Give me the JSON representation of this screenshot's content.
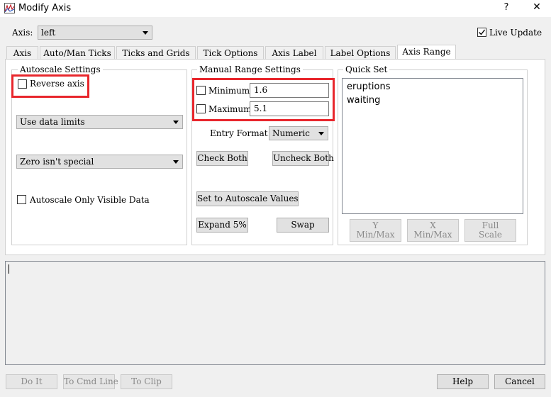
{
  "window": {
    "title": "Modify Axis",
    "help_label": "?",
    "close_label": "✕"
  },
  "axis": {
    "label": "Axis:",
    "selected": "left"
  },
  "live_update": {
    "label": "Live Update",
    "checked": true
  },
  "tabs": [
    {
      "label": "Axis"
    },
    {
      "label": "Auto/Man Ticks"
    },
    {
      "label": "Ticks and Grids"
    },
    {
      "label": "Tick Options"
    },
    {
      "label": "Axis Label"
    },
    {
      "label": "Label Options"
    },
    {
      "label": "Axis Range",
      "active": true
    }
  ],
  "autoscale": {
    "title": "Autoscale Settings",
    "reverse_axis": "Reverse axis",
    "limits_select": "Use data limits",
    "zero_select": "Zero isn't special",
    "visible_only": "Autoscale Only Visible Data"
  },
  "manual": {
    "title": "Manual Range Settings",
    "minimum_label": "Minimum:",
    "minimum_value": "1.6",
    "maximum_label": "Maximum:",
    "maximum_value": "5.1",
    "entry_format_label": "Entry Format:",
    "entry_format_value": "Numeric",
    "check_both": "Check Both",
    "uncheck_both": "Uncheck Both",
    "set_autoscale": "Set to Autoscale Values",
    "expand": "Expand 5%",
    "swap": "Swap"
  },
  "quickset": {
    "title": "Quick Set",
    "items": [
      "eruptions",
      "waiting"
    ],
    "y_minmax_1": "Y",
    "y_minmax_2": "Min/Max",
    "x_minmax_1": "X",
    "x_minmax_2": "Min/Max",
    "full_scale_1": "Full",
    "full_scale_2": "Scale"
  },
  "bottom": {
    "do_it": "Do It",
    "to_cmd_line": "To Cmd Line",
    "to_clip": "To Clip",
    "help": "Help",
    "cancel": "Cancel"
  },
  "colors": {
    "highlight": "#e8262c",
    "dialog_bg": "#f0f0f0"
  }
}
